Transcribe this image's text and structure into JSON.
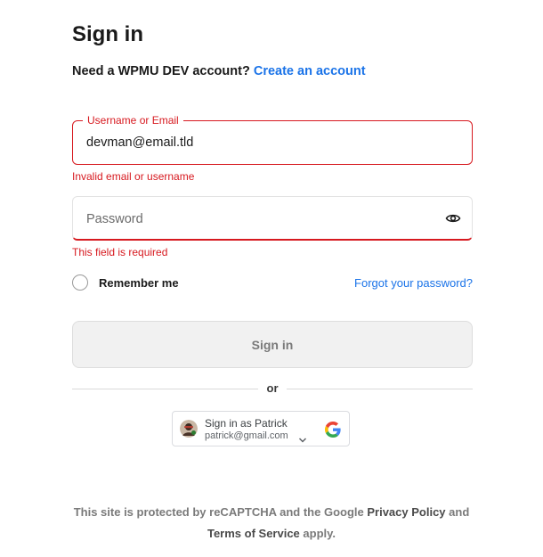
{
  "header": {
    "title": "Sign in",
    "account_prompt": "Need a WPMU DEV account?",
    "create_account_link": "Create an account"
  },
  "form": {
    "username": {
      "label": "Username or Email",
      "value": "devman@email.tld",
      "error": "Invalid email or username"
    },
    "password": {
      "placeholder": "Password",
      "error": "This field is required"
    },
    "remember_label": "Remember me",
    "forgot_link": "Forgot your password?",
    "submit_label": "Sign in",
    "divider_text": "or"
  },
  "google": {
    "label": "Sign in as Patrick",
    "email": "patrick@gmail.com"
  },
  "footer": {
    "prefix": "This site is protected by reCAPTCHA and the Google",
    "privacy_link": "Privacy Policy",
    "conjunction": "and",
    "terms_link": "Terms of Service",
    "suffix": "apply."
  },
  "colors": {
    "accent": "#1a73e8",
    "error": "#d7191f",
    "button_bg": "#f1f1f1"
  },
  "icons": {
    "password_toggle": "eye-icon",
    "remember": "radio-icon",
    "google_account": "chevron-down-icon",
    "google_brand": "google-logo-icon"
  }
}
